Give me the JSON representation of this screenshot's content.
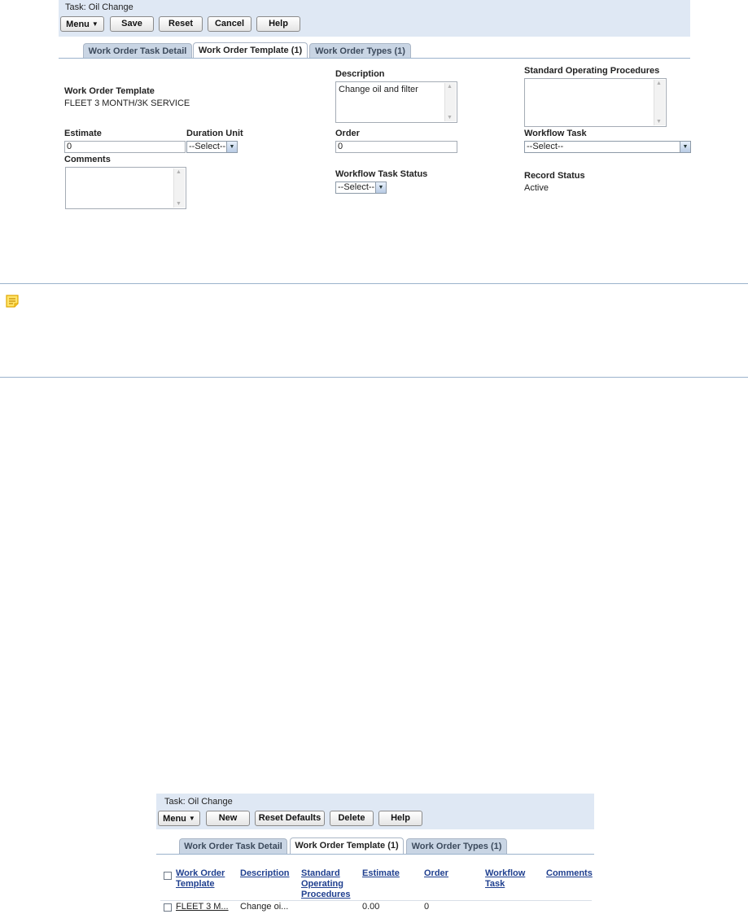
{
  "top": {
    "task_title": "Task: Oil Change",
    "toolbar": {
      "menu": "Menu",
      "save": "Save",
      "reset": "Reset",
      "cancel": "Cancel",
      "help": "Help"
    },
    "tabs": [
      {
        "label": "Work Order Task Detail",
        "active": false
      },
      {
        "label": "Work Order Template (1)",
        "active": true
      },
      {
        "label": "Work Order Types (1)",
        "active": false
      }
    ],
    "form": {
      "work_order_template_label": "Work Order Template",
      "work_order_template_value": "FLEET 3 MONTH/3K SERVICE",
      "description_label": "Description",
      "description_value": "Change oil and filter",
      "sop_label": "Standard Operating Procedures",
      "sop_value": "",
      "estimate_label": "Estimate",
      "estimate_value": "0",
      "duration_unit_label": "Duration Unit",
      "duration_unit_value": "--Select--",
      "order_label": "Order",
      "order_value": "0",
      "workflow_task_label": "Workflow Task",
      "workflow_task_value": "--Select--",
      "comments_label": "Comments",
      "comments_value": "",
      "workflow_task_status_label": "Workflow Task Status",
      "workflow_task_status_value": "--Select--",
      "record_status_label": "Record Status",
      "record_status_value": "Active"
    }
  },
  "bottom": {
    "task_title": "Task: Oil Change",
    "toolbar": {
      "menu": "Menu",
      "new": "New",
      "reset_defaults": "Reset Defaults",
      "delete": "Delete",
      "help": "Help"
    },
    "tabs": [
      {
        "label": "Work Order Task Detail",
        "active": false
      },
      {
        "label": "Work Order Template (1)",
        "active": true
      },
      {
        "label": "Work Order Types (1)",
        "active": false
      }
    ],
    "table": {
      "headers": {
        "work_order_template": [
          "Work Order",
          "Template"
        ],
        "description": "Description",
        "sop": [
          "Standard",
          "Operating",
          "Procedures"
        ],
        "estimate": "Estimate",
        "order": "Order",
        "workflow_task": [
          "Workflow",
          "Task"
        ],
        "comments": "Comments"
      },
      "rows": [
        {
          "work_order_template": "FLEET 3 M...",
          "description": "Change oi...",
          "sop": "",
          "estimate": "0.00",
          "order": "0",
          "workflow_task": "",
          "comments": ""
        }
      ]
    }
  },
  "colors": {
    "panel_bg": "#dfe8f4",
    "tab_bg": "#c9d5e4",
    "divider": "#9bb3cc",
    "link": "#1f3f8f",
    "note_icon": "#f0b400"
  }
}
